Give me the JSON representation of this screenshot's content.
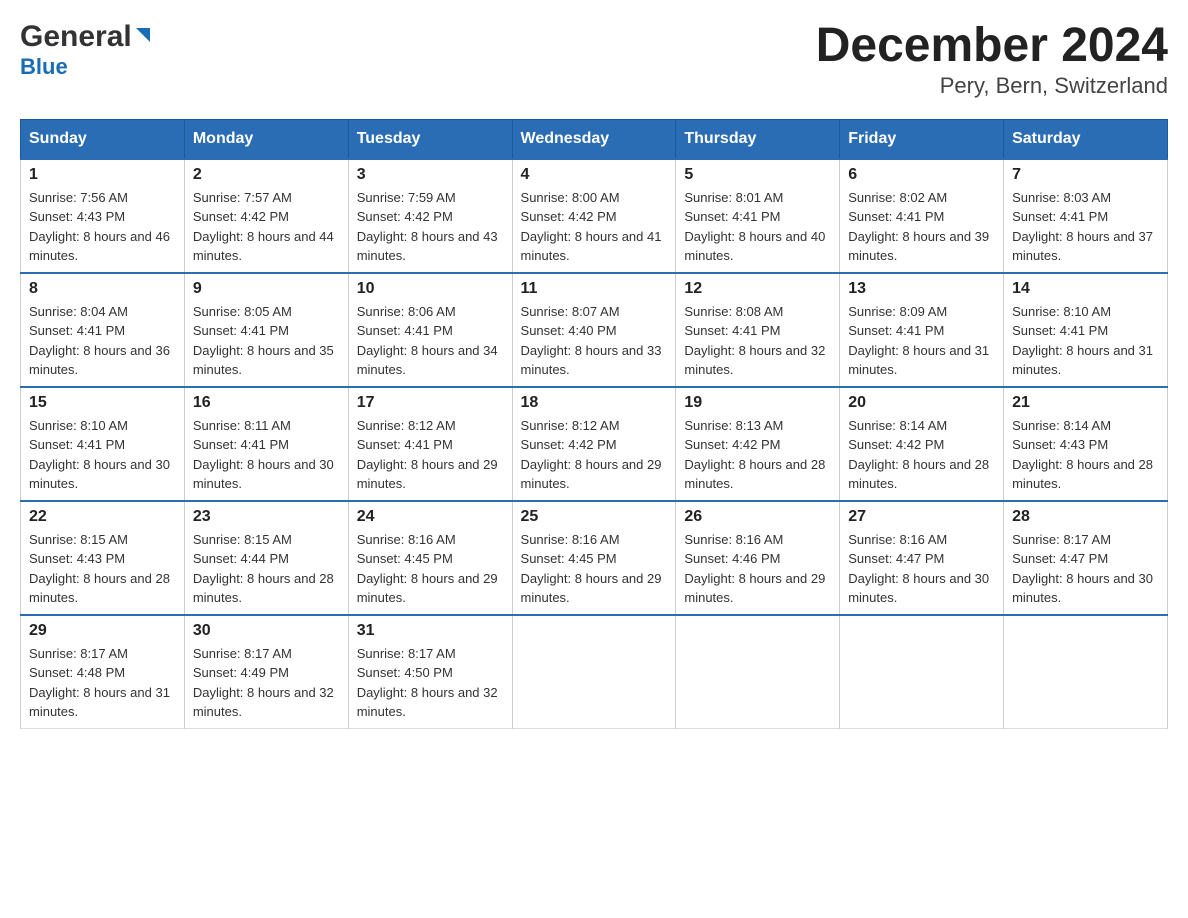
{
  "header": {
    "logo_general": "General",
    "logo_blue": "Blue",
    "title": "December 2024",
    "subtitle": "Pery, Bern, Switzerland"
  },
  "days_of_week": [
    "Sunday",
    "Monday",
    "Tuesday",
    "Wednesday",
    "Thursday",
    "Friday",
    "Saturday"
  ],
  "weeks": [
    [
      {
        "day": "1",
        "sunrise": "7:56 AM",
        "sunset": "4:43 PM",
        "daylight": "8 hours and 46 minutes."
      },
      {
        "day": "2",
        "sunrise": "7:57 AM",
        "sunset": "4:42 PM",
        "daylight": "8 hours and 44 minutes."
      },
      {
        "day": "3",
        "sunrise": "7:59 AM",
        "sunset": "4:42 PM",
        "daylight": "8 hours and 43 minutes."
      },
      {
        "day": "4",
        "sunrise": "8:00 AM",
        "sunset": "4:42 PM",
        "daylight": "8 hours and 41 minutes."
      },
      {
        "day": "5",
        "sunrise": "8:01 AM",
        "sunset": "4:41 PM",
        "daylight": "8 hours and 40 minutes."
      },
      {
        "day": "6",
        "sunrise": "8:02 AM",
        "sunset": "4:41 PM",
        "daylight": "8 hours and 39 minutes."
      },
      {
        "day": "7",
        "sunrise": "8:03 AM",
        "sunset": "4:41 PM",
        "daylight": "8 hours and 37 minutes."
      }
    ],
    [
      {
        "day": "8",
        "sunrise": "8:04 AM",
        "sunset": "4:41 PM",
        "daylight": "8 hours and 36 minutes."
      },
      {
        "day": "9",
        "sunrise": "8:05 AM",
        "sunset": "4:41 PM",
        "daylight": "8 hours and 35 minutes."
      },
      {
        "day": "10",
        "sunrise": "8:06 AM",
        "sunset": "4:41 PM",
        "daylight": "8 hours and 34 minutes."
      },
      {
        "day": "11",
        "sunrise": "8:07 AM",
        "sunset": "4:40 PM",
        "daylight": "8 hours and 33 minutes."
      },
      {
        "day": "12",
        "sunrise": "8:08 AM",
        "sunset": "4:41 PM",
        "daylight": "8 hours and 32 minutes."
      },
      {
        "day": "13",
        "sunrise": "8:09 AM",
        "sunset": "4:41 PM",
        "daylight": "8 hours and 31 minutes."
      },
      {
        "day": "14",
        "sunrise": "8:10 AM",
        "sunset": "4:41 PM",
        "daylight": "8 hours and 31 minutes."
      }
    ],
    [
      {
        "day": "15",
        "sunrise": "8:10 AM",
        "sunset": "4:41 PM",
        "daylight": "8 hours and 30 minutes."
      },
      {
        "day": "16",
        "sunrise": "8:11 AM",
        "sunset": "4:41 PM",
        "daylight": "8 hours and 30 minutes."
      },
      {
        "day": "17",
        "sunrise": "8:12 AM",
        "sunset": "4:41 PM",
        "daylight": "8 hours and 29 minutes."
      },
      {
        "day": "18",
        "sunrise": "8:12 AM",
        "sunset": "4:42 PM",
        "daylight": "8 hours and 29 minutes."
      },
      {
        "day": "19",
        "sunrise": "8:13 AM",
        "sunset": "4:42 PM",
        "daylight": "8 hours and 28 minutes."
      },
      {
        "day": "20",
        "sunrise": "8:14 AM",
        "sunset": "4:42 PM",
        "daylight": "8 hours and 28 minutes."
      },
      {
        "day": "21",
        "sunrise": "8:14 AM",
        "sunset": "4:43 PM",
        "daylight": "8 hours and 28 minutes."
      }
    ],
    [
      {
        "day": "22",
        "sunrise": "8:15 AM",
        "sunset": "4:43 PM",
        "daylight": "8 hours and 28 minutes."
      },
      {
        "day": "23",
        "sunrise": "8:15 AM",
        "sunset": "4:44 PM",
        "daylight": "8 hours and 28 minutes."
      },
      {
        "day": "24",
        "sunrise": "8:16 AM",
        "sunset": "4:45 PM",
        "daylight": "8 hours and 29 minutes."
      },
      {
        "day": "25",
        "sunrise": "8:16 AM",
        "sunset": "4:45 PM",
        "daylight": "8 hours and 29 minutes."
      },
      {
        "day": "26",
        "sunrise": "8:16 AM",
        "sunset": "4:46 PM",
        "daylight": "8 hours and 29 minutes."
      },
      {
        "day": "27",
        "sunrise": "8:16 AM",
        "sunset": "4:47 PM",
        "daylight": "8 hours and 30 minutes."
      },
      {
        "day": "28",
        "sunrise": "8:17 AM",
        "sunset": "4:47 PM",
        "daylight": "8 hours and 30 minutes."
      }
    ],
    [
      {
        "day": "29",
        "sunrise": "8:17 AM",
        "sunset": "4:48 PM",
        "daylight": "8 hours and 31 minutes."
      },
      {
        "day": "30",
        "sunrise": "8:17 AM",
        "sunset": "4:49 PM",
        "daylight": "8 hours and 32 minutes."
      },
      {
        "day": "31",
        "sunrise": "8:17 AM",
        "sunset": "4:50 PM",
        "daylight": "8 hours and 32 minutes."
      },
      null,
      null,
      null,
      null
    ]
  ]
}
